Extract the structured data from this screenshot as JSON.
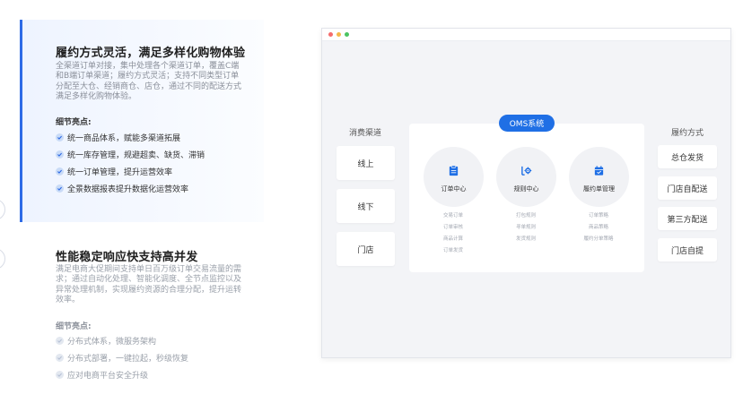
{
  "section1": {
    "title": "履约方式灵活，满足多样化购物体验",
    "desc": "全渠道订单对接，集中处理各个渠道订单，覆盖C端和B端订单渠道；履约方式灵活；支持不同类型订单分配至大仓、经销商仓、店仓，通过不同的配送方式满足多样化购物体验。",
    "highlight_label": "细节亮点:",
    "highlights": [
      "统一商品体系，赋能多渠道拓展",
      "统一库存管理，规避超卖、缺货、滞销",
      "统一订单管理，提升运营效率",
      "全景数据报表提升数据化运营效率"
    ]
  },
  "section2": {
    "title": "性能稳定响应快支持高并发",
    "desc": "满足电商大促期间支持单日百万级订单交易流量的需求；通过自动化处理、智能化调度、全节点监控以及异常处理机制，实现履约资源的合理分配，提升运转效率。",
    "highlight_label": "细节亮点:",
    "highlights": [
      "分布式体系，微服务架构",
      "分布式部署，一键拉起，秒级恢复",
      "应对电商平台安全升级"
    ]
  },
  "window": {
    "dots": [
      "#f56c6c",
      "#f5b94a",
      "#4cc462"
    ],
    "left_title": "消费渠道",
    "left_items": [
      "线上",
      "线下",
      "门店"
    ],
    "center_badge": "OMS系统",
    "right_title": "履约方式",
    "right_items": [
      "总仓发货",
      "门店自配送",
      "第三方配送",
      "门店自提"
    ],
    "modules": [
      {
        "label": "订单中心",
        "icon": "order-icon",
        "subs": [
          "交易订单",
          "订单审核",
          "商品计算",
          "订单发货"
        ]
      },
      {
        "label": "规则中心",
        "icon": "rule-icon",
        "subs": [
          "打包规则",
          "寻单规则",
          "发货规则"
        ]
      },
      {
        "label": "履约单管理",
        "icon": "fulfillment-icon",
        "subs": [
          "订单策略",
          "商品策略",
          "履约分单策略"
        ]
      }
    ]
  },
  "colors": {
    "accent": "#1f6fe5",
    "active_border": "#2e6be6"
  }
}
